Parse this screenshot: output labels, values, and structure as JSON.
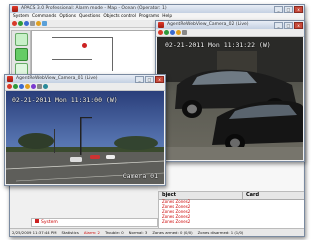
{
  "main_window": {
    "title": "APACS 3.0 Professional: Alarm mode - Map - Ocean (Operator: 1)",
    "menu": [
      "System",
      "Commands",
      "Options",
      "Questions",
      "Objects control",
      "Programs",
      "Help"
    ],
    "tree_items": [
      "Zones Zones2",
      "Zones Zones2",
      "Zones Zones2",
      "Zones Zones2",
      "Zones Zones2"
    ],
    "grid_header": {
      "object": "bject",
      "card": "Card"
    },
    "bottom_item": "System",
    "status": {
      "datetime": "2/25/2009 11:37:44 PM",
      "statistics": "Statistics",
      "alarm_label": "Alarm:",
      "alarm_value": "2",
      "trouble_label": "Trouble:",
      "trouble_value": "0",
      "normal_label": "Normal:",
      "normal_value": "3",
      "zones_armed": "Zones armed: 0 (0/0)",
      "zones_disarmed": "Zones disarmed: 1 (1/0)"
    }
  },
  "camera_window_2": {
    "title": "AgentReWebView_Camera_02 (Live)",
    "osd_timestamp": "02-21-2011 Mon 11:31:22 (W)"
  },
  "camera_window_1": {
    "title": "AgentReWebView_Camera_01 (Live)",
    "osd_timestamp": "02-21-2011 Mon 11:31:00 (W)",
    "osd_label": "Camera 01"
  },
  "colors": {
    "accent": "#cc2222",
    "titlebar": "#c4d0e2"
  }
}
